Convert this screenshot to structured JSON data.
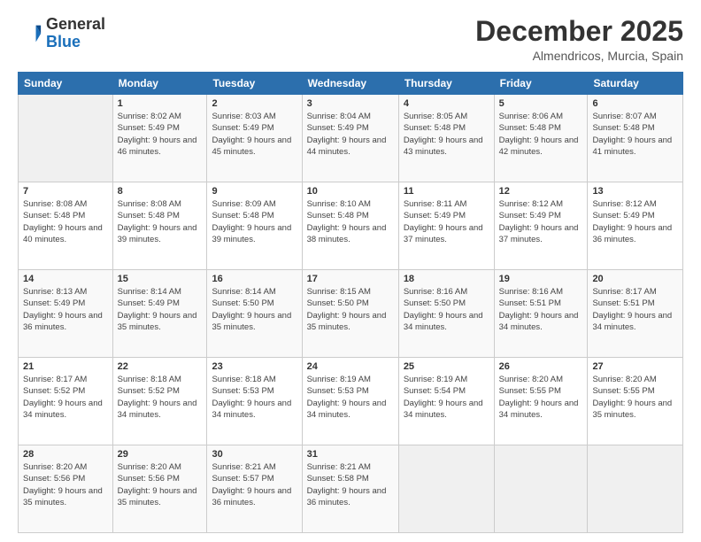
{
  "header": {
    "logo_general": "General",
    "logo_blue": "Blue",
    "month_title": "December 2025",
    "location": "Almendricos, Murcia, Spain"
  },
  "days_of_week": [
    "Sunday",
    "Monday",
    "Tuesday",
    "Wednesday",
    "Thursday",
    "Friday",
    "Saturday"
  ],
  "weeks": [
    [
      {
        "day": "",
        "sunrise": "",
        "sunset": "",
        "daylight": "",
        "empty": true
      },
      {
        "day": "1",
        "sunrise": "Sunrise: 8:02 AM",
        "sunset": "Sunset: 5:49 PM",
        "daylight": "Daylight: 9 hours and 46 minutes."
      },
      {
        "day": "2",
        "sunrise": "Sunrise: 8:03 AM",
        "sunset": "Sunset: 5:49 PM",
        "daylight": "Daylight: 9 hours and 45 minutes."
      },
      {
        "day": "3",
        "sunrise": "Sunrise: 8:04 AM",
        "sunset": "Sunset: 5:49 PM",
        "daylight": "Daylight: 9 hours and 44 minutes."
      },
      {
        "day": "4",
        "sunrise": "Sunrise: 8:05 AM",
        "sunset": "Sunset: 5:48 PM",
        "daylight": "Daylight: 9 hours and 43 minutes."
      },
      {
        "day": "5",
        "sunrise": "Sunrise: 8:06 AM",
        "sunset": "Sunset: 5:48 PM",
        "daylight": "Daylight: 9 hours and 42 minutes."
      },
      {
        "day": "6",
        "sunrise": "Sunrise: 8:07 AM",
        "sunset": "Sunset: 5:48 PM",
        "daylight": "Daylight: 9 hours and 41 minutes."
      }
    ],
    [
      {
        "day": "7",
        "sunrise": "Sunrise: 8:08 AM",
        "sunset": "Sunset: 5:48 PM",
        "daylight": "Daylight: 9 hours and 40 minutes."
      },
      {
        "day": "8",
        "sunrise": "Sunrise: 8:08 AM",
        "sunset": "Sunset: 5:48 PM",
        "daylight": "Daylight: 9 hours and 39 minutes."
      },
      {
        "day": "9",
        "sunrise": "Sunrise: 8:09 AM",
        "sunset": "Sunset: 5:48 PM",
        "daylight": "Daylight: 9 hours and 39 minutes."
      },
      {
        "day": "10",
        "sunrise": "Sunrise: 8:10 AM",
        "sunset": "Sunset: 5:48 PM",
        "daylight": "Daylight: 9 hours and 38 minutes."
      },
      {
        "day": "11",
        "sunrise": "Sunrise: 8:11 AM",
        "sunset": "Sunset: 5:49 PM",
        "daylight": "Daylight: 9 hours and 37 minutes."
      },
      {
        "day": "12",
        "sunrise": "Sunrise: 8:12 AM",
        "sunset": "Sunset: 5:49 PM",
        "daylight": "Daylight: 9 hours and 37 minutes."
      },
      {
        "day": "13",
        "sunrise": "Sunrise: 8:12 AM",
        "sunset": "Sunset: 5:49 PM",
        "daylight": "Daylight: 9 hours and 36 minutes."
      }
    ],
    [
      {
        "day": "14",
        "sunrise": "Sunrise: 8:13 AM",
        "sunset": "Sunset: 5:49 PM",
        "daylight": "Daylight: 9 hours and 36 minutes."
      },
      {
        "day": "15",
        "sunrise": "Sunrise: 8:14 AM",
        "sunset": "Sunset: 5:49 PM",
        "daylight": "Daylight: 9 hours and 35 minutes."
      },
      {
        "day": "16",
        "sunrise": "Sunrise: 8:14 AM",
        "sunset": "Sunset: 5:50 PM",
        "daylight": "Daylight: 9 hours and 35 minutes."
      },
      {
        "day": "17",
        "sunrise": "Sunrise: 8:15 AM",
        "sunset": "Sunset: 5:50 PM",
        "daylight": "Daylight: 9 hours and 35 minutes."
      },
      {
        "day": "18",
        "sunrise": "Sunrise: 8:16 AM",
        "sunset": "Sunset: 5:50 PM",
        "daylight": "Daylight: 9 hours and 34 minutes."
      },
      {
        "day": "19",
        "sunrise": "Sunrise: 8:16 AM",
        "sunset": "Sunset: 5:51 PM",
        "daylight": "Daylight: 9 hours and 34 minutes."
      },
      {
        "day": "20",
        "sunrise": "Sunrise: 8:17 AM",
        "sunset": "Sunset: 5:51 PM",
        "daylight": "Daylight: 9 hours and 34 minutes."
      }
    ],
    [
      {
        "day": "21",
        "sunrise": "Sunrise: 8:17 AM",
        "sunset": "Sunset: 5:52 PM",
        "daylight": "Daylight: 9 hours and 34 minutes."
      },
      {
        "day": "22",
        "sunrise": "Sunrise: 8:18 AM",
        "sunset": "Sunset: 5:52 PM",
        "daylight": "Daylight: 9 hours and 34 minutes."
      },
      {
        "day": "23",
        "sunrise": "Sunrise: 8:18 AM",
        "sunset": "Sunset: 5:53 PM",
        "daylight": "Daylight: 9 hours and 34 minutes."
      },
      {
        "day": "24",
        "sunrise": "Sunrise: 8:19 AM",
        "sunset": "Sunset: 5:53 PM",
        "daylight": "Daylight: 9 hours and 34 minutes."
      },
      {
        "day": "25",
        "sunrise": "Sunrise: 8:19 AM",
        "sunset": "Sunset: 5:54 PM",
        "daylight": "Daylight: 9 hours and 34 minutes."
      },
      {
        "day": "26",
        "sunrise": "Sunrise: 8:20 AM",
        "sunset": "Sunset: 5:55 PM",
        "daylight": "Daylight: 9 hours and 34 minutes."
      },
      {
        "day": "27",
        "sunrise": "Sunrise: 8:20 AM",
        "sunset": "Sunset: 5:55 PM",
        "daylight": "Daylight: 9 hours and 35 minutes."
      }
    ],
    [
      {
        "day": "28",
        "sunrise": "Sunrise: 8:20 AM",
        "sunset": "Sunset: 5:56 PM",
        "daylight": "Daylight: 9 hours and 35 minutes."
      },
      {
        "day": "29",
        "sunrise": "Sunrise: 8:20 AM",
        "sunset": "Sunset: 5:56 PM",
        "daylight": "Daylight: 9 hours and 35 minutes."
      },
      {
        "day": "30",
        "sunrise": "Sunrise: 8:21 AM",
        "sunset": "Sunset: 5:57 PM",
        "daylight": "Daylight: 9 hours and 36 minutes."
      },
      {
        "day": "31",
        "sunrise": "Sunrise: 8:21 AM",
        "sunset": "Sunset: 5:58 PM",
        "daylight": "Daylight: 9 hours and 36 minutes."
      },
      {
        "day": "",
        "sunrise": "",
        "sunset": "",
        "daylight": "",
        "empty": true
      },
      {
        "day": "",
        "sunrise": "",
        "sunset": "",
        "daylight": "",
        "empty": true
      },
      {
        "day": "",
        "sunrise": "",
        "sunset": "",
        "daylight": "",
        "empty": true
      }
    ]
  ]
}
